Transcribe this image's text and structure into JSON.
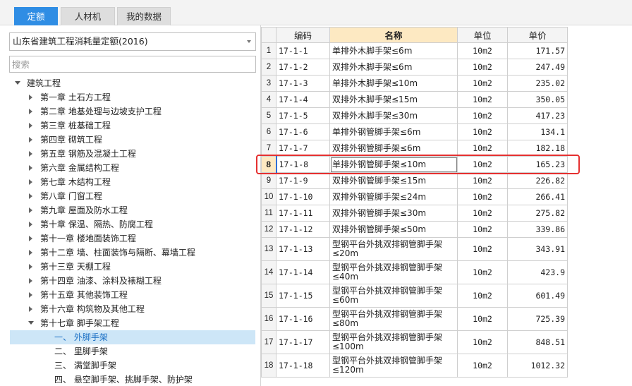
{
  "tabs": [
    {
      "label": "定额",
      "active": true
    },
    {
      "label": "人材机",
      "active": false
    },
    {
      "label": "我的数据",
      "active": false
    }
  ],
  "library_select": {
    "value": "山东省建筑工程消耗量定额(2016)"
  },
  "search": {
    "placeholder": "搜索"
  },
  "tree": {
    "root": "建筑工程",
    "chapters": [
      "第一章 土石方工程",
      "第二章 地基处理与边坡支护工程",
      "第三章 桩基础工程",
      "第四章 砌筑工程",
      "第五章 钢筋及混凝土工程",
      "第六章 金属结构工程",
      "第七章 木结构工程",
      "第八章 门窗工程",
      "第九章 屋面及防水工程",
      "第十章 保温、隔热、防腐工程",
      "第十一章 楼地面装饰工程",
      "第十二章 墙、柱面装饰与隔断、幕墙工程",
      "第十三章 天棚工程",
      "第十四章 油漆、涂料及裱糊工程",
      "第十五章 其他装饰工程",
      "第十六章 构筑物及其他工程",
      "第十七章 脚手架工程"
    ],
    "sub_items": [
      "一、 外脚手架",
      "二、 里脚手架",
      "三、 满堂脚手架",
      "四、 悬空脚手架、挑脚手架、防护架"
    ],
    "selected_sub_index": 0
  },
  "table": {
    "headers": {
      "code": "编码",
      "name": "名称",
      "unit": "单位",
      "price": "单价"
    },
    "rows": [
      {
        "no": "1",
        "code": "17-1-1",
        "name": "单排外木脚手架≤6m",
        "unit": "10m2",
        "price": "171.57"
      },
      {
        "no": "2",
        "code": "17-1-2",
        "name": "双排外木脚手架≤6m",
        "unit": "10m2",
        "price": "247.49"
      },
      {
        "no": "3",
        "code": "17-1-3",
        "name": "单排外木脚手架≤10m",
        "unit": "10m2",
        "price": "235.02"
      },
      {
        "no": "4",
        "code": "17-1-4",
        "name": "双排外木脚手架≤15m",
        "unit": "10m2",
        "price": "350.05"
      },
      {
        "no": "5",
        "code": "17-1-5",
        "name": "双排外木脚手架≤30m",
        "unit": "10m2",
        "price": "417.23"
      },
      {
        "no": "6",
        "code": "17-1-6",
        "name": "单排外钢管脚手架≤6m",
        "unit": "10m2",
        "price": "134.1"
      },
      {
        "no": "7",
        "code": "17-1-7",
        "name": "双排外钢管脚手架≤6m",
        "unit": "10m2",
        "price": "182.18"
      },
      {
        "no": "8",
        "code": "17-1-8",
        "name": "单排外钢管脚手架≤10m",
        "unit": "10m2",
        "price": "165.23"
      },
      {
        "no": "9",
        "code": "17-1-9",
        "name": "双排外钢管脚手架≤15m",
        "unit": "10m2",
        "price": "226.82"
      },
      {
        "no": "10",
        "code": "17-1-10",
        "name": "双排外钢管脚手架≤24m",
        "unit": "10m2",
        "price": "266.41"
      },
      {
        "no": "11",
        "code": "17-1-11",
        "name": "双排外钢管脚手架≤30m",
        "unit": "10m2",
        "price": "275.82"
      },
      {
        "no": "12",
        "code": "17-1-12",
        "name": "双排外钢管脚手架≤50m",
        "unit": "10m2",
        "price": "339.86"
      },
      {
        "no": "13",
        "code": "17-1-13",
        "name": "型钢平台外挑双排钢管脚手架≤20m",
        "unit": "10m2",
        "price": "343.91"
      },
      {
        "no": "14",
        "code": "17-1-14",
        "name": "型钢平台外挑双排钢管脚手架≤40m",
        "unit": "10m2",
        "price": "423.9"
      },
      {
        "no": "15",
        "code": "17-1-15",
        "name": "型钢平台外挑双排钢管脚手架≤60m",
        "unit": "10m2",
        "price": "601.49"
      },
      {
        "no": "16",
        "code": "17-1-16",
        "name": "型钢平台外挑双排钢管脚手架≤80m",
        "unit": "10m2",
        "price": "725.39"
      },
      {
        "no": "17",
        "code": "17-1-17",
        "name": "型钢平台外挑双排钢管脚手架≤100m",
        "unit": "10m2",
        "price": "848.51"
      },
      {
        "no": "18",
        "code": "17-1-18",
        "name": "型钢平台外挑双排钢管脚手架≤120m",
        "unit": "10m2",
        "price": "1012.32"
      }
    ],
    "selected_row": 7
  }
}
